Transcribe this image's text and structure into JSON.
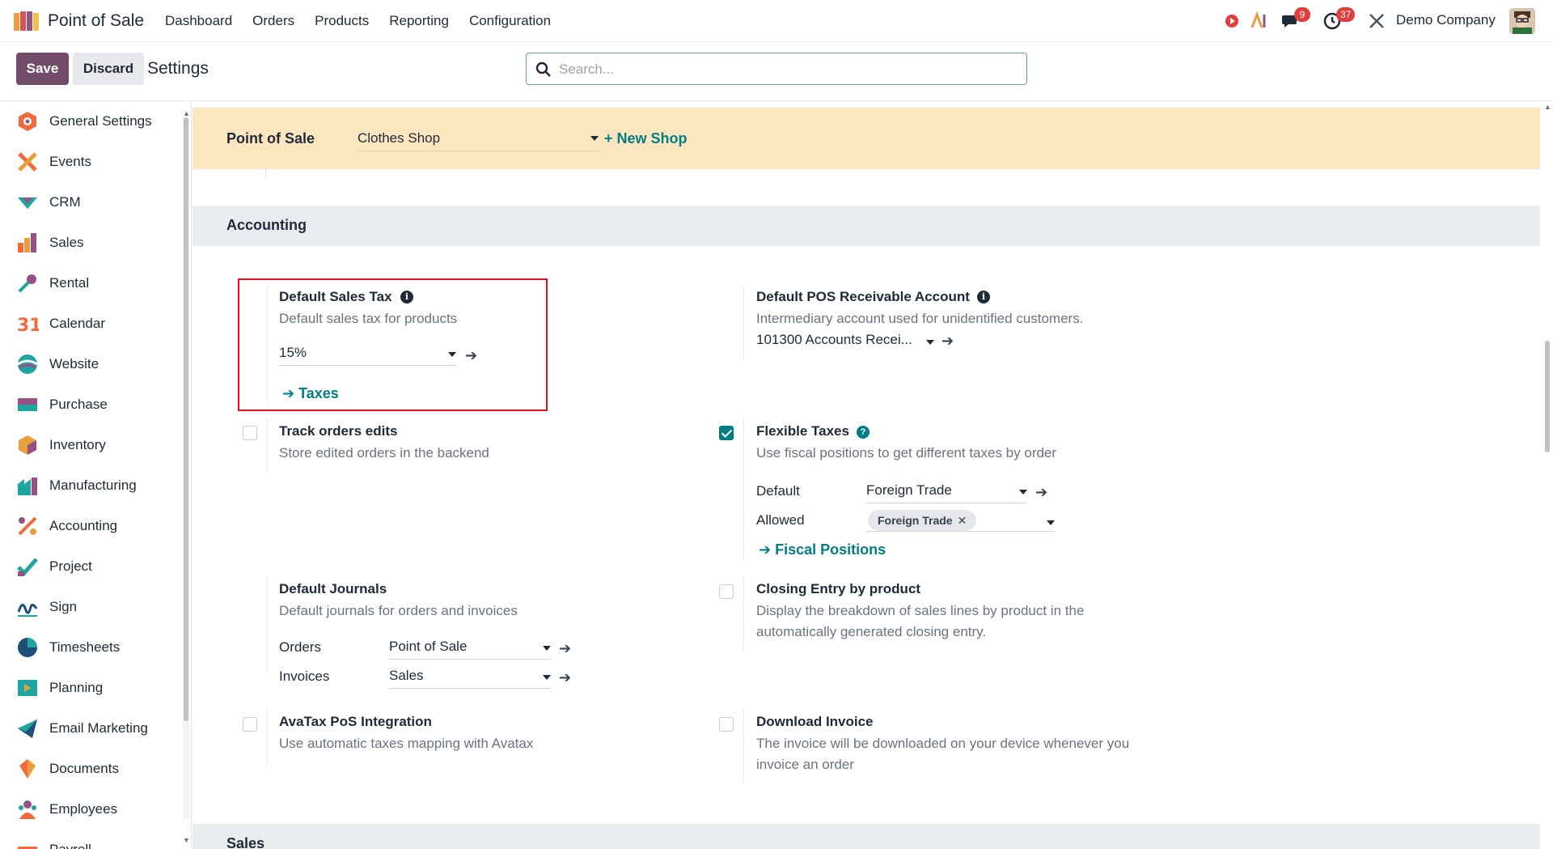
{
  "topnav": {
    "app_title": "Point of Sale",
    "menu": [
      "Dashboard",
      "Orders",
      "Products",
      "Reporting",
      "Configuration"
    ],
    "chat_badge": "9",
    "activity_badge": "37",
    "company": "Demo Company"
  },
  "control": {
    "save_label": "Save",
    "discard_label": "Discard",
    "title": "Settings",
    "search_placeholder": "Search..."
  },
  "sidebar": {
    "items": [
      {
        "label": "General Settings",
        "icon": "general-settings-icon"
      },
      {
        "label": "Events",
        "icon": "events-icon"
      },
      {
        "label": "CRM",
        "icon": "crm-icon"
      },
      {
        "label": "Sales",
        "icon": "sales-icon"
      },
      {
        "label": "Rental",
        "icon": "rental-icon"
      },
      {
        "label": "Calendar",
        "icon": "calendar-icon"
      },
      {
        "label": "Website",
        "icon": "website-icon"
      },
      {
        "label": "Purchase",
        "icon": "purchase-icon"
      },
      {
        "label": "Inventory",
        "icon": "inventory-icon"
      },
      {
        "label": "Manufacturing",
        "icon": "manufacturing-icon"
      },
      {
        "label": "Accounting",
        "icon": "accounting-icon"
      },
      {
        "label": "Project",
        "icon": "project-icon"
      },
      {
        "label": "Sign",
        "icon": "sign-icon"
      },
      {
        "label": "Timesheets",
        "icon": "timesheets-icon"
      },
      {
        "label": "Planning",
        "icon": "planning-icon"
      },
      {
        "label": "Email Marketing",
        "icon": "email-marketing-icon"
      },
      {
        "label": "Documents",
        "icon": "documents-icon"
      },
      {
        "label": "Employees",
        "icon": "employees-icon"
      },
      {
        "label": "Payroll",
        "icon": "payroll-icon"
      }
    ]
  },
  "shop": {
    "label": "Point of Sale",
    "value": "Clothes Shop",
    "new_shop": "+ New Shop"
  },
  "accounting": {
    "section_title": "Accounting",
    "default_sales_tax": {
      "title": "Default Sales Tax",
      "desc": "Default sales tax for products",
      "value": "15%",
      "link": "Taxes"
    },
    "receivable": {
      "title": "Default POS Receivable Account",
      "desc": "Intermediary account used for unidentified customers.",
      "value": "101300 Accounts Recei..."
    },
    "track_edits": {
      "title": "Track orders edits",
      "desc": "Store edited orders in the backend",
      "checked": false
    },
    "flexible_taxes": {
      "title": "Flexible Taxes",
      "desc": "Use fiscal positions to get different taxes by order",
      "checked": true,
      "default_label": "Default",
      "default_value": "Foreign Trade",
      "allowed_label": "Allowed",
      "allowed_tag": "Foreign Trade",
      "link": "Fiscal Positions"
    },
    "journals": {
      "title": "Default Journals",
      "desc": "Default journals for orders and invoices",
      "orders_label": "Orders",
      "orders_value": "Point of Sale",
      "invoices_label": "Invoices",
      "invoices_value": "Sales"
    },
    "closing_entry": {
      "title": "Closing Entry by product",
      "desc_line1": "Display the breakdown of sales lines by product in the",
      "desc_line2": "automatically generated closing entry.",
      "checked": false
    },
    "avatax": {
      "title": "AvaTax PoS Integration",
      "desc": "Use automatic taxes mapping with Avatax",
      "checked": false
    },
    "download_invoice": {
      "title": "Download Invoice",
      "desc_line1": "The invoice will be downloaded on your device whenever you",
      "desc_line2": "invoice an order",
      "checked": false
    }
  },
  "sales": {
    "section_title": "Sales"
  },
  "colors": {
    "brand": "#714b67",
    "link": "#017e84",
    "highlight": "#e0141e",
    "banner": "#fbe6c0"
  }
}
